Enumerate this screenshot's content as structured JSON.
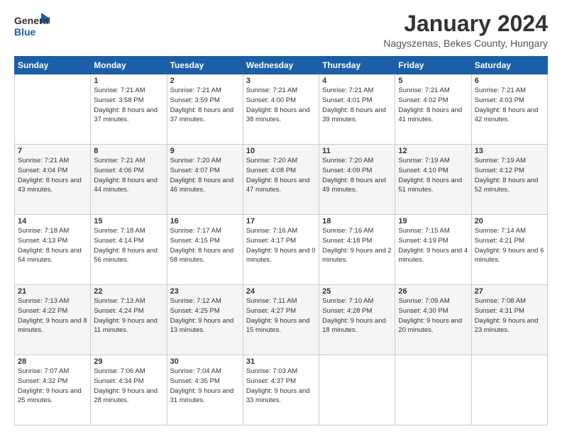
{
  "logo": {
    "general": "General",
    "blue": "Blue"
  },
  "title": "January 2024",
  "subtitle": "Nagyszenas, Bekes County, Hungary",
  "headers": [
    "Sunday",
    "Monday",
    "Tuesday",
    "Wednesday",
    "Thursday",
    "Friday",
    "Saturday"
  ],
  "weeks": [
    [
      {
        "day": "",
        "sunrise": "",
        "sunset": "",
        "daylight": ""
      },
      {
        "day": "1",
        "sunrise": "Sunrise: 7:21 AM",
        "sunset": "Sunset: 3:58 PM",
        "daylight": "Daylight: 8 hours and 37 minutes."
      },
      {
        "day": "2",
        "sunrise": "Sunrise: 7:21 AM",
        "sunset": "Sunset: 3:59 PM",
        "daylight": "Daylight: 8 hours and 37 minutes."
      },
      {
        "day": "3",
        "sunrise": "Sunrise: 7:21 AM",
        "sunset": "Sunset: 4:00 PM",
        "daylight": "Daylight: 8 hours and 38 minutes."
      },
      {
        "day": "4",
        "sunrise": "Sunrise: 7:21 AM",
        "sunset": "Sunset: 4:01 PM",
        "daylight": "Daylight: 8 hours and 39 minutes."
      },
      {
        "day": "5",
        "sunrise": "Sunrise: 7:21 AM",
        "sunset": "Sunset: 4:02 PM",
        "daylight": "Daylight: 8 hours and 41 minutes."
      },
      {
        "day": "6",
        "sunrise": "Sunrise: 7:21 AM",
        "sunset": "Sunset: 4:03 PM",
        "daylight": "Daylight: 8 hours and 42 minutes."
      }
    ],
    [
      {
        "day": "7",
        "sunrise": "Sunrise: 7:21 AM",
        "sunset": "Sunset: 4:04 PM",
        "daylight": "Daylight: 8 hours and 43 minutes."
      },
      {
        "day": "8",
        "sunrise": "Sunrise: 7:21 AM",
        "sunset": "Sunset: 4:06 PM",
        "daylight": "Daylight: 8 hours and 44 minutes."
      },
      {
        "day": "9",
        "sunrise": "Sunrise: 7:20 AM",
        "sunset": "Sunset: 4:07 PM",
        "daylight": "Daylight: 8 hours and 46 minutes."
      },
      {
        "day": "10",
        "sunrise": "Sunrise: 7:20 AM",
        "sunset": "Sunset: 4:08 PM",
        "daylight": "Daylight: 8 hours and 47 minutes."
      },
      {
        "day": "11",
        "sunrise": "Sunrise: 7:20 AM",
        "sunset": "Sunset: 4:09 PM",
        "daylight": "Daylight: 8 hours and 49 minutes."
      },
      {
        "day": "12",
        "sunrise": "Sunrise: 7:19 AM",
        "sunset": "Sunset: 4:10 PM",
        "daylight": "Daylight: 8 hours and 51 minutes."
      },
      {
        "day": "13",
        "sunrise": "Sunrise: 7:19 AM",
        "sunset": "Sunset: 4:12 PM",
        "daylight": "Daylight: 8 hours and 52 minutes."
      }
    ],
    [
      {
        "day": "14",
        "sunrise": "Sunrise: 7:18 AM",
        "sunset": "Sunset: 4:13 PM",
        "daylight": "Daylight: 8 hours and 54 minutes."
      },
      {
        "day": "15",
        "sunrise": "Sunrise: 7:18 AM",
        "sunset": "Sunset: 4:14 PM",
        "daylight": "Daylight: 8 hours and 56 minutes."
      },
      {
        "day": "16",
        "sunrise": "Sunrise: 7:17 AM",
        "sunset": "Sunset: 4:15 PM",
        "daylight": "Daylight: 8 hours and 58 minutes."
      },
      {
        "day": "17",
        "sunrise": "Sunrise: 7:16 AM",
        "sunset": "Sunset: 4:17 PM",
        "daylight": "Daylight: 9 hours and 0 minutes."
      },
      {
        "day": "18",
        "sunrise": "Sunrise: 7:16 AM",
        "sunset": "Sunset: 4:18 PM",
        "daylight": "Daylight: 9 hours and 2 minutes."
      },
      {
        "day": "19",
        "sunrise": "Sunrise: 7:15 AM",
        "sunset": "Sunset: 4:19 PM",
        "daylight": "Daylight: 9 hours and 4 minutes."
      },
      {
        "day": "20",
        "sunrise": "Sunrise: 7:14 AM",
        "sunset": "Sunset: 4:21 PM",
        "daylight": "Daylight: 9 hours and 6 minutes."
      }
    ],
    [
      {
        "day": "21",
        "sunrise": "Sunrise: 7:13 AM",
        "sunset": "Sunset: 4:22 PM",
        "daylight": "Daylight: 9 hours and 8 minutes."
      },
      {
        "day": "22",
        "sunrise": "Sunrise: 7:13 AM",
        "sunset": "Sunset: 4:24 PM",
        "daylight": "Daylight: 9 hours and 11 minutes."
      },
      {
        "day": "23",
        "sunrise": "Sunrise: 7:12 AM",
        "sunset": "Sunset: 4:25 PM",
        "daylight": "Daylight: 9 hours and 13 minutes."
      },
      {
        "day": "24",
        "sunrise": "Sunrise: 7:11 AM",
        "sunset": "Sunset: 4:27 PM",
        "daylight": "Daylight: 9 hours and 15 minutes."
      },
      {
        "day": "25",
        "sunrise": "Sunrise: 7:10 AM",
        "sunset": "Sunset: 4:28 PM",
        "daylight": "Daylight: 9 hours and 18 minutes."
      },
      {
        "day": "26",
        "sunrise": "Sunrise: 7:09 AM",
        "sunset": "Sunset: 4:30 PM",
        "daylight": "Daylight: 9 hours and 20 minutes."
      },
      {
        "day": "27",
        "sunrise": "Sunrise: 7:08 AM",
        "sunset": "Sunset: 4:31 PM",
        "daylight": "Daylight: 9 hours and 23 minutes."
      }
    ],
    [
      {
        "day": "28",
        "sunrise": "Sunrise: 7:07 AM",
        "sunset": "Sunset: 4:32 PM",
        "daylight": "Daylight: 9 hours and 25 minutes."
      },
      {
        "day": "29",
        "sunrise": "Sunrise: 7:06 AM",
        "sunset": "Sunset: 4:34 PM",
        "daylight": "Daylight: 9 hours and 28 minutes."
      },
      {
        "day": "30",
        "sunrise": "Sunrise: 7:04 AM",
        "sunset": "Sunset: 4:35 PM",
        "daylight": "Daylight: 9 hours and 31 minutes."
      },
      {
        "day": "31",
        "sunrise": "Sunrise: 7:03 AM",
        "sunset": "Sunset: 4:37 PM",
        "daylight": "Daylight: 9 hours and 33 minutes."
      },
      {
        "day": "",
        "sunrise": "",
        "sunset": "",
        "daylight": ""
      },
      {
        "day": "",
        "sunrise": "",
        "sunset": "",
        "daylight": ""
      },
      {
        "day": "",
        "sunrise": "",
        "sunset": "",
        "daylight": ""
      }
    ]
  ]
}
